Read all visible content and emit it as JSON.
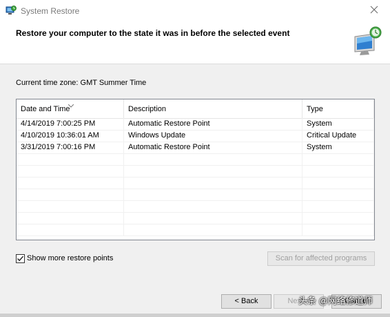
{
  "window": {
    "title": "System Restore",
    "close_icon": "close-icon",
    "app_icon": "system-restore-icon"
  },
  "header": {
    "title": "Restore your computer to the state it was in before the selected event",
    "icon": "monitor-restore-icon"
  },
  "timezone": {
    "label": "Current time zone: GMT Summer Time"
  },
  "list": {
    "columns": [
      "Date and Time",
      "Description",
      "Type"
    ],
    "sort_icon": "sort-down-icon",
    "rows": [
      [
        "4/14/2019 7:00:25 PM",
        "Automatic Restore Point",
        "System"
      ],
      [
        "4/10/2019 10:36:01 AM",
        "Windows Update",
        "Critical Update"
      ],
      [
        "3/31/2019 7:00:16 PM",
        "Automatic Restore Point",
        "System"
      ]
    ]
  },
  "show_more": {
    "label": "Show more restore points",
    "checked": true
  },
  "buttons": {
    "scan": "Scan for affected programs",
    "back": "< Back",
    "next": "Next >",
    "cancel": "Cancel"
  },
  "watermark": "头条 @网络修道师"
}
